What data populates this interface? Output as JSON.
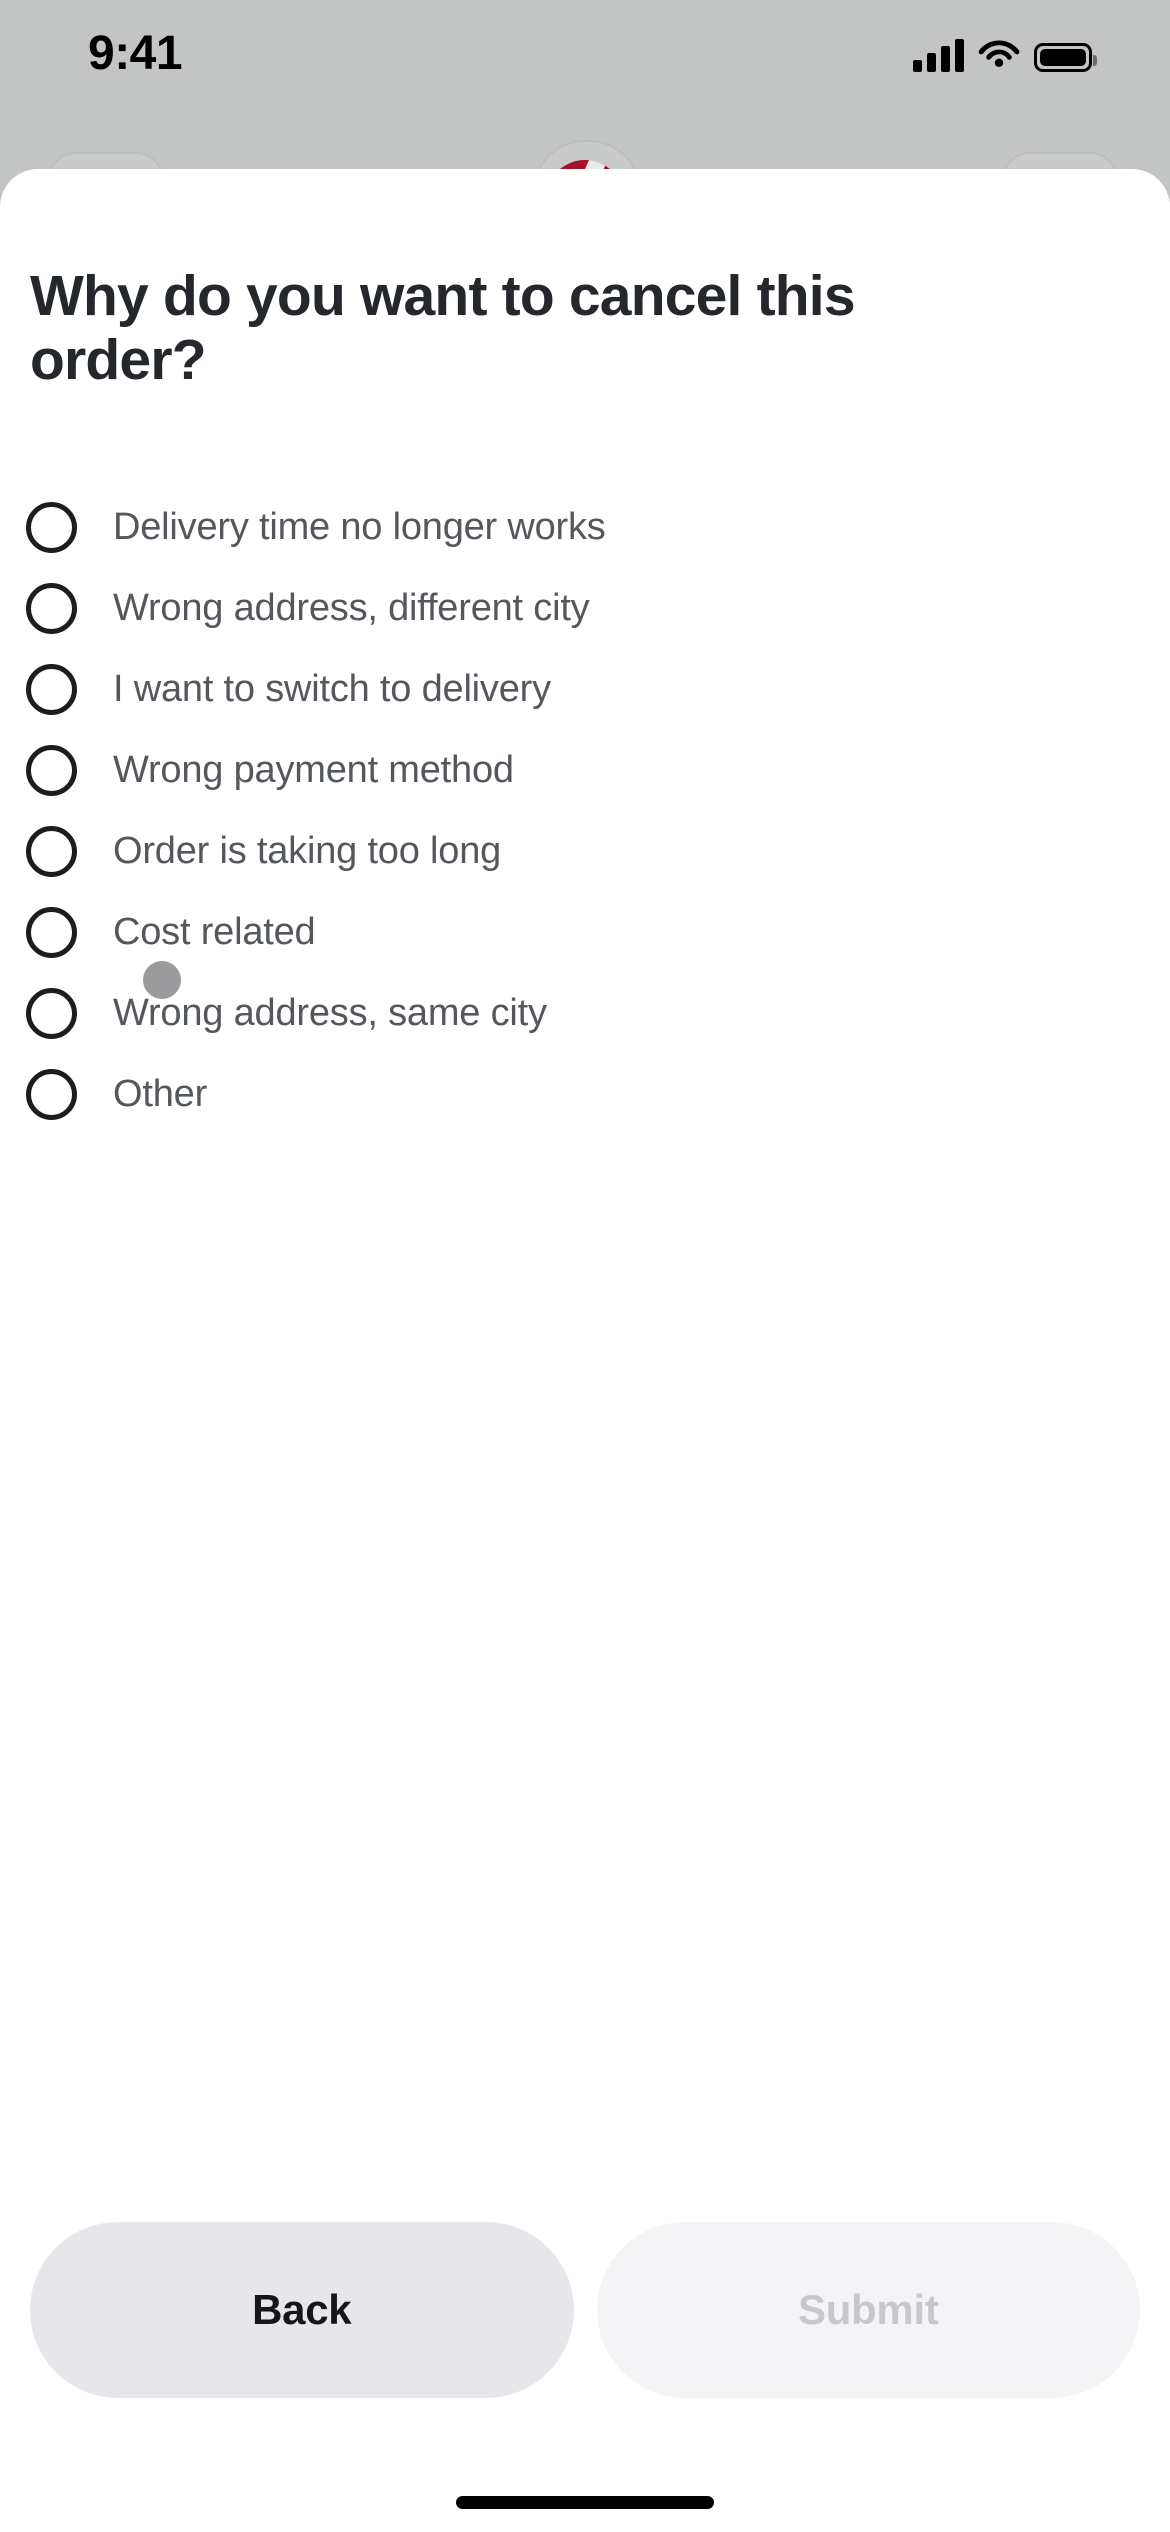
{
  "status_bar": {
    "time": "9:41",
    "cellular_icon": "cellular-signal-icon",
    "wifi_icon": "wifi-icon",
    "battery_icon": "battery-full-icon"
  },
  "background": {
    "logo_icon": "app-logo-icon",
    "logo_color": "#a4112a",
    "overlay_color": "#c3c4c4"
  },
  "sheet": {
    "title": "Why do you want to cancel this order?",
    "options": [
      {
        "label": "Delivery time no longer works",
        "selected": false
      },
      {
        "label": "Wrong address, different city",
        "selected": false
      },
      {
        "label": "I want to switch to delivery",
        "selected": false
      },
      {
        "label": "Wrong payment method",
        "selected": false
      },
      {
        "label": "Order is taking too long",
        "selected": false
      },
      {
        "label": "Cost related",
        "selected": false
      },
      {
        "label": "Wrong address, same city",
        "selected": false
      },
      {
        "label": "Other",
        "selected": false
      }
    ]
  },
  "footer": {
    "back_label": "Back",
    "submit_label": "Submit",
    "submit_enabled": false
  },
  "colors": {
    "title_text": "#24272c",
    "option_text": "#54585d",
    "radio_border": "#1b1d20",
    "back_button_bg": "#e7e7eb",
    "submit_button_bg": "#f4f4f6",
    "submit_button_text": "#c8c8cc",
    "touch_dot": "#9b9b9e"
  },
  "touch_indicator": {
    "name": "touch-point-indicator"
  },
  "home_indicator": {
    "name": "home-indicator"
  }
}
